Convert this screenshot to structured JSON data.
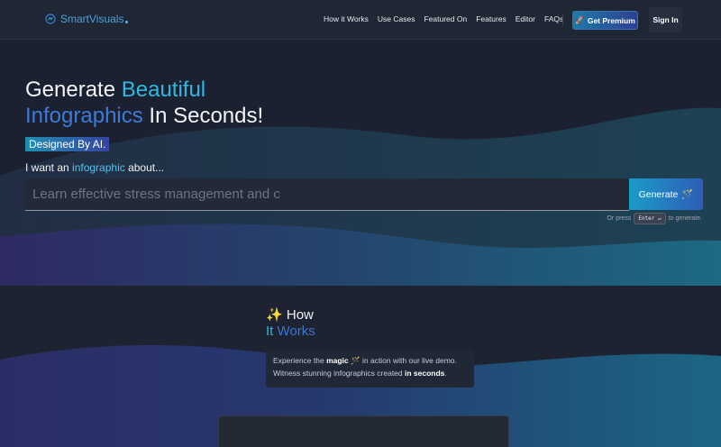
{
  "nav": {
    "brand": "SmartVisuals",
    "links": [
      "How it Works",
      "Use Cases",
      "Featured On",
      "Features",
      "Editor",
      "FAQs"
    ],
    "premium_icon": "rocket-icon",
    "premium_label": "Get Premium",
    "signin_label": "Sign In"
  },
  "hero": {
    "headline_1": "Generate ",
    "headline_2": "Beautiful",
    "headline_3": "Infographics",
    "headline_4": " In Seconds!",
    "badge": "Designed By AI.",
    "prompt_1": "I want an ",
    "prompt_2": "infographic",
    "prompt_3": " about...",
    "search_placeholder": "Learn effective stress management and c",
    "generate_label": "Generate",
    "generate_icon": "magic-wand-icon",
    "hint_prefix": "Or press",
    "hint_key": "Enter ↵",
    "hint_suffix": "to generate."
  },
  "how_it_works": {
    "title_icon": "sparkles-icon",
    "title_1": "How",
    "title_2": "It ",
    "title_3": "Works",
    "desc_1": "Experience the ",
    "desc_2": "magic",
    "desc_3": " in action with our live demo.",
    "desc_4": "Witness stunning infographics created ",
    "desc_5": "in seconds",
    "desc_6": "."
  },
  "colors": {
    "accent_cyan": "#2fb8e2",
    "accent_blue": "#3d7bd6",
    "background": "#1c2333"
  }
}
